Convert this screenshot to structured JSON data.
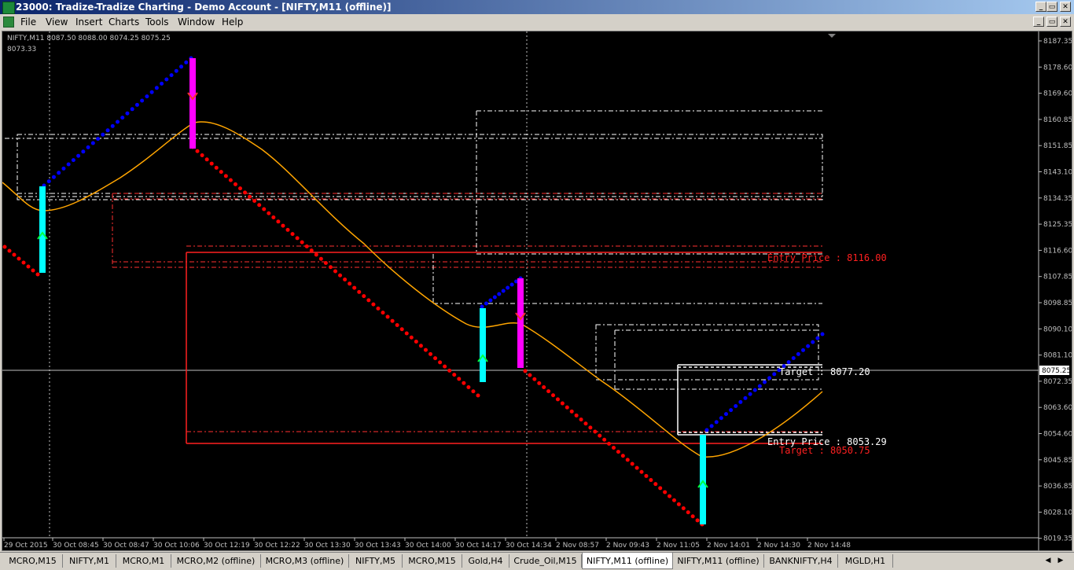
{
  "window": {
    "title": "23000: Tradize-Tradize Charting - Demo Account - [NIFTY,M11 (offline)]",
    "buttons": [
      "_",
      "▭",
      "✕"
    ],
    "child_buttons": [
      "_",
      "▭",
      "✕"
    ]
  },
  "menu": [
    "File",
    "View",
    "Insert",
    "Charts",
    "Tools",
    "Window",
    "Help"
  ],
  "chart": {
    "symbol_line": "NIFTY,M11  8087.50 8088.00 8074.25 8075.25",
    "value_line": "8073.33",
    "current_price": "8075.25",
    "y_ticks": [
      "8187.35",
      "8178.60",
      "8169.60",
      "8160.85",
      "8151.85",
      "8143.10",
      "8134.35",
      "8125.35",
      "8116.60",
      "8107.85",
      "8098.85",
      "8090.10",
      "8081.10",
      "8072.35",
      "8063.60",
      "8054.60",
      "8045.85",
      "8036.85",
      "8028.10",
      "8019.35"
    ],
    "x_ticks": [
      "29 Oct 2015",
      "30 Oct 08:45",
      "30 Oct 08:47",
      "30 Oct 10:06",
      "30 Oct 12:19",
      "30 Oct 12:22",
      "30 Oct 13:30",
      "30 Oct 13:43",
      "30 Oct 14:00",
      "30 Oct 14:17",
      "30 Oct 14:34",
      "2 Nov 08:57",
      "2 Nov 09:43",
      "2 Nov 11:05",
      "2 Nov 14:01",
      "2 Nov 14:30",
      "2 Nov 14:48"
    ],
    "annotations": {
      "entry_price_red": "Entry Price : 8116.00",
      "target_white": "Target : 8077.20",
      "entry_price_white": "Entry Price : 8053.29",
      "target_red": "Target : 8050.75"
    },
    "colors": {
      "background": "#000000",
      "up_dots": "#0000ff",
      "down_dots": "#ff0000",
      "moving_average": "#ffa500",
      "buy_arrow": "#00ffff",
      "sell_arrow": "#ff00ff",
      "price_line": "#c0c0c0"
    }
  },
  "tabs": [
    "MCRO,M15",
    "NIFTY,M1",
    "MCRO,M1",
    "MCRO,M2 (offline)",
    "MCRO,M3 (offline)",
    "NIFTY,M5",
    "MCRO,M15",
    "Gold,H4",
    "Crude_Oil,M15",
    "NIFTY,M11 (offline)",
    "NIFTY,M11 (offline)",
    "BANKNIFTY,H4",
    "MGLD,H1"
  ],
  "active_tab_index": 9
}
